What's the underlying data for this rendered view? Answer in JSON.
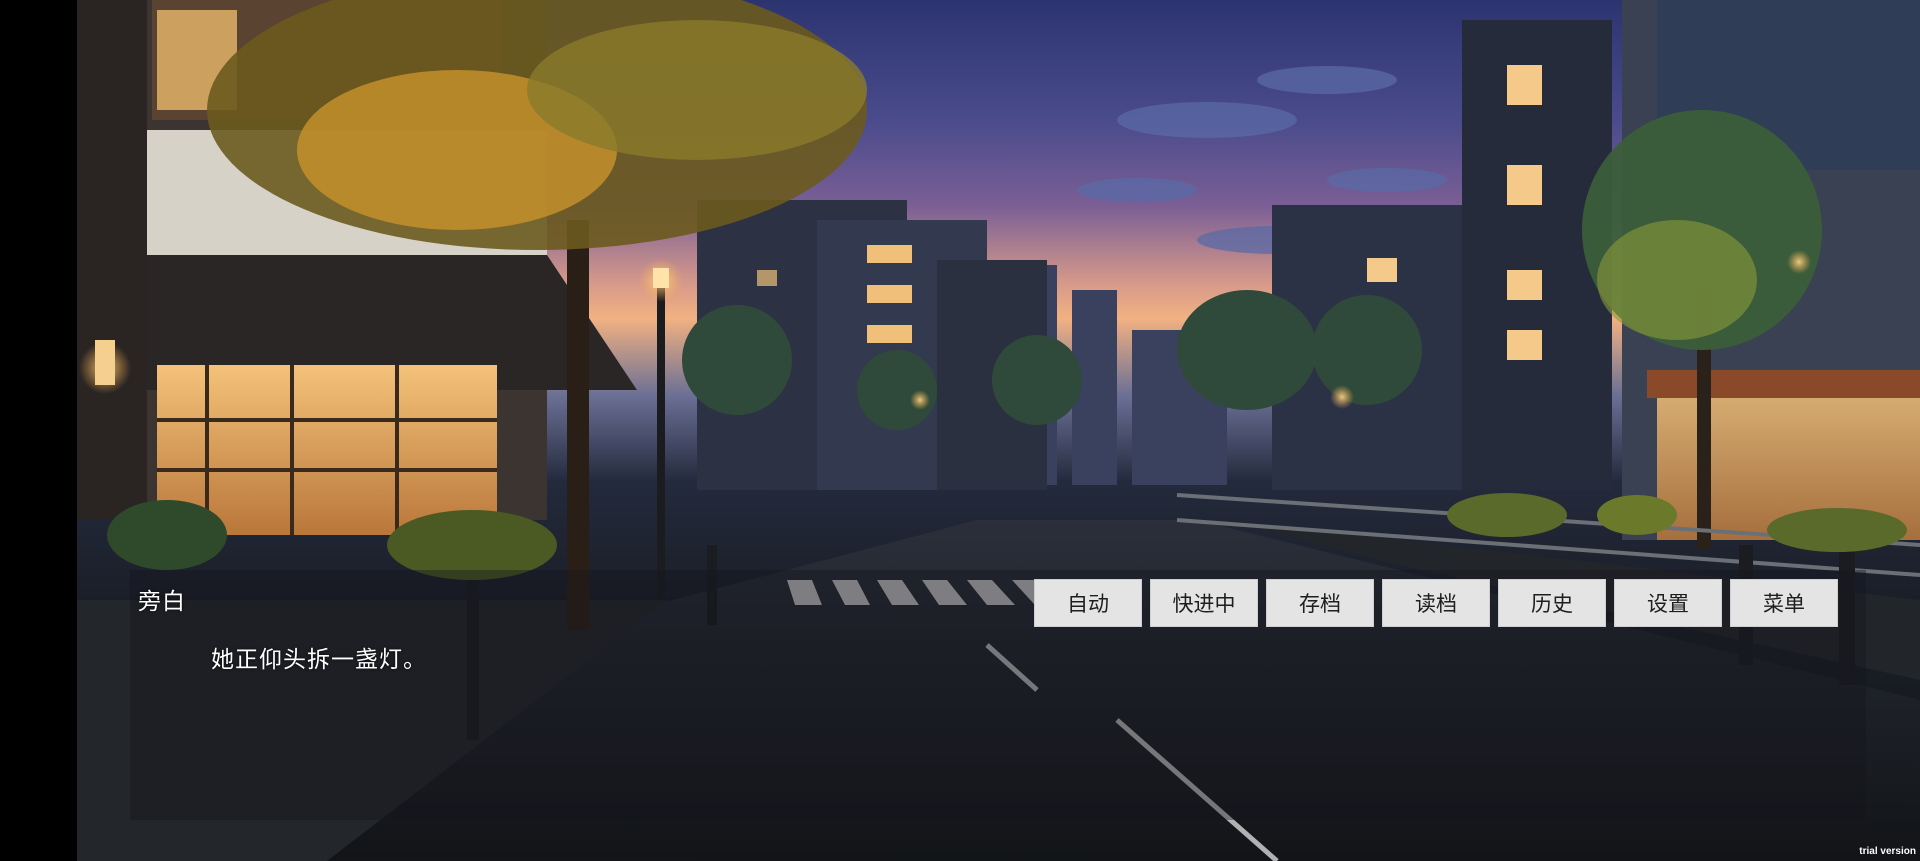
{
  "dialogue": {
    "speaker": "旁白",
    "text": "她正仰头拆一盏灯。"
  },
  "quick_menu": {
    "auto": "自动",
    "skip": "快进中",
    "save": "存档",
    "load": "读档",
    "history": "历史",
    "settings": "设置",
    "menu": "菜单"
  },
  "watermark": "trial version"
}
